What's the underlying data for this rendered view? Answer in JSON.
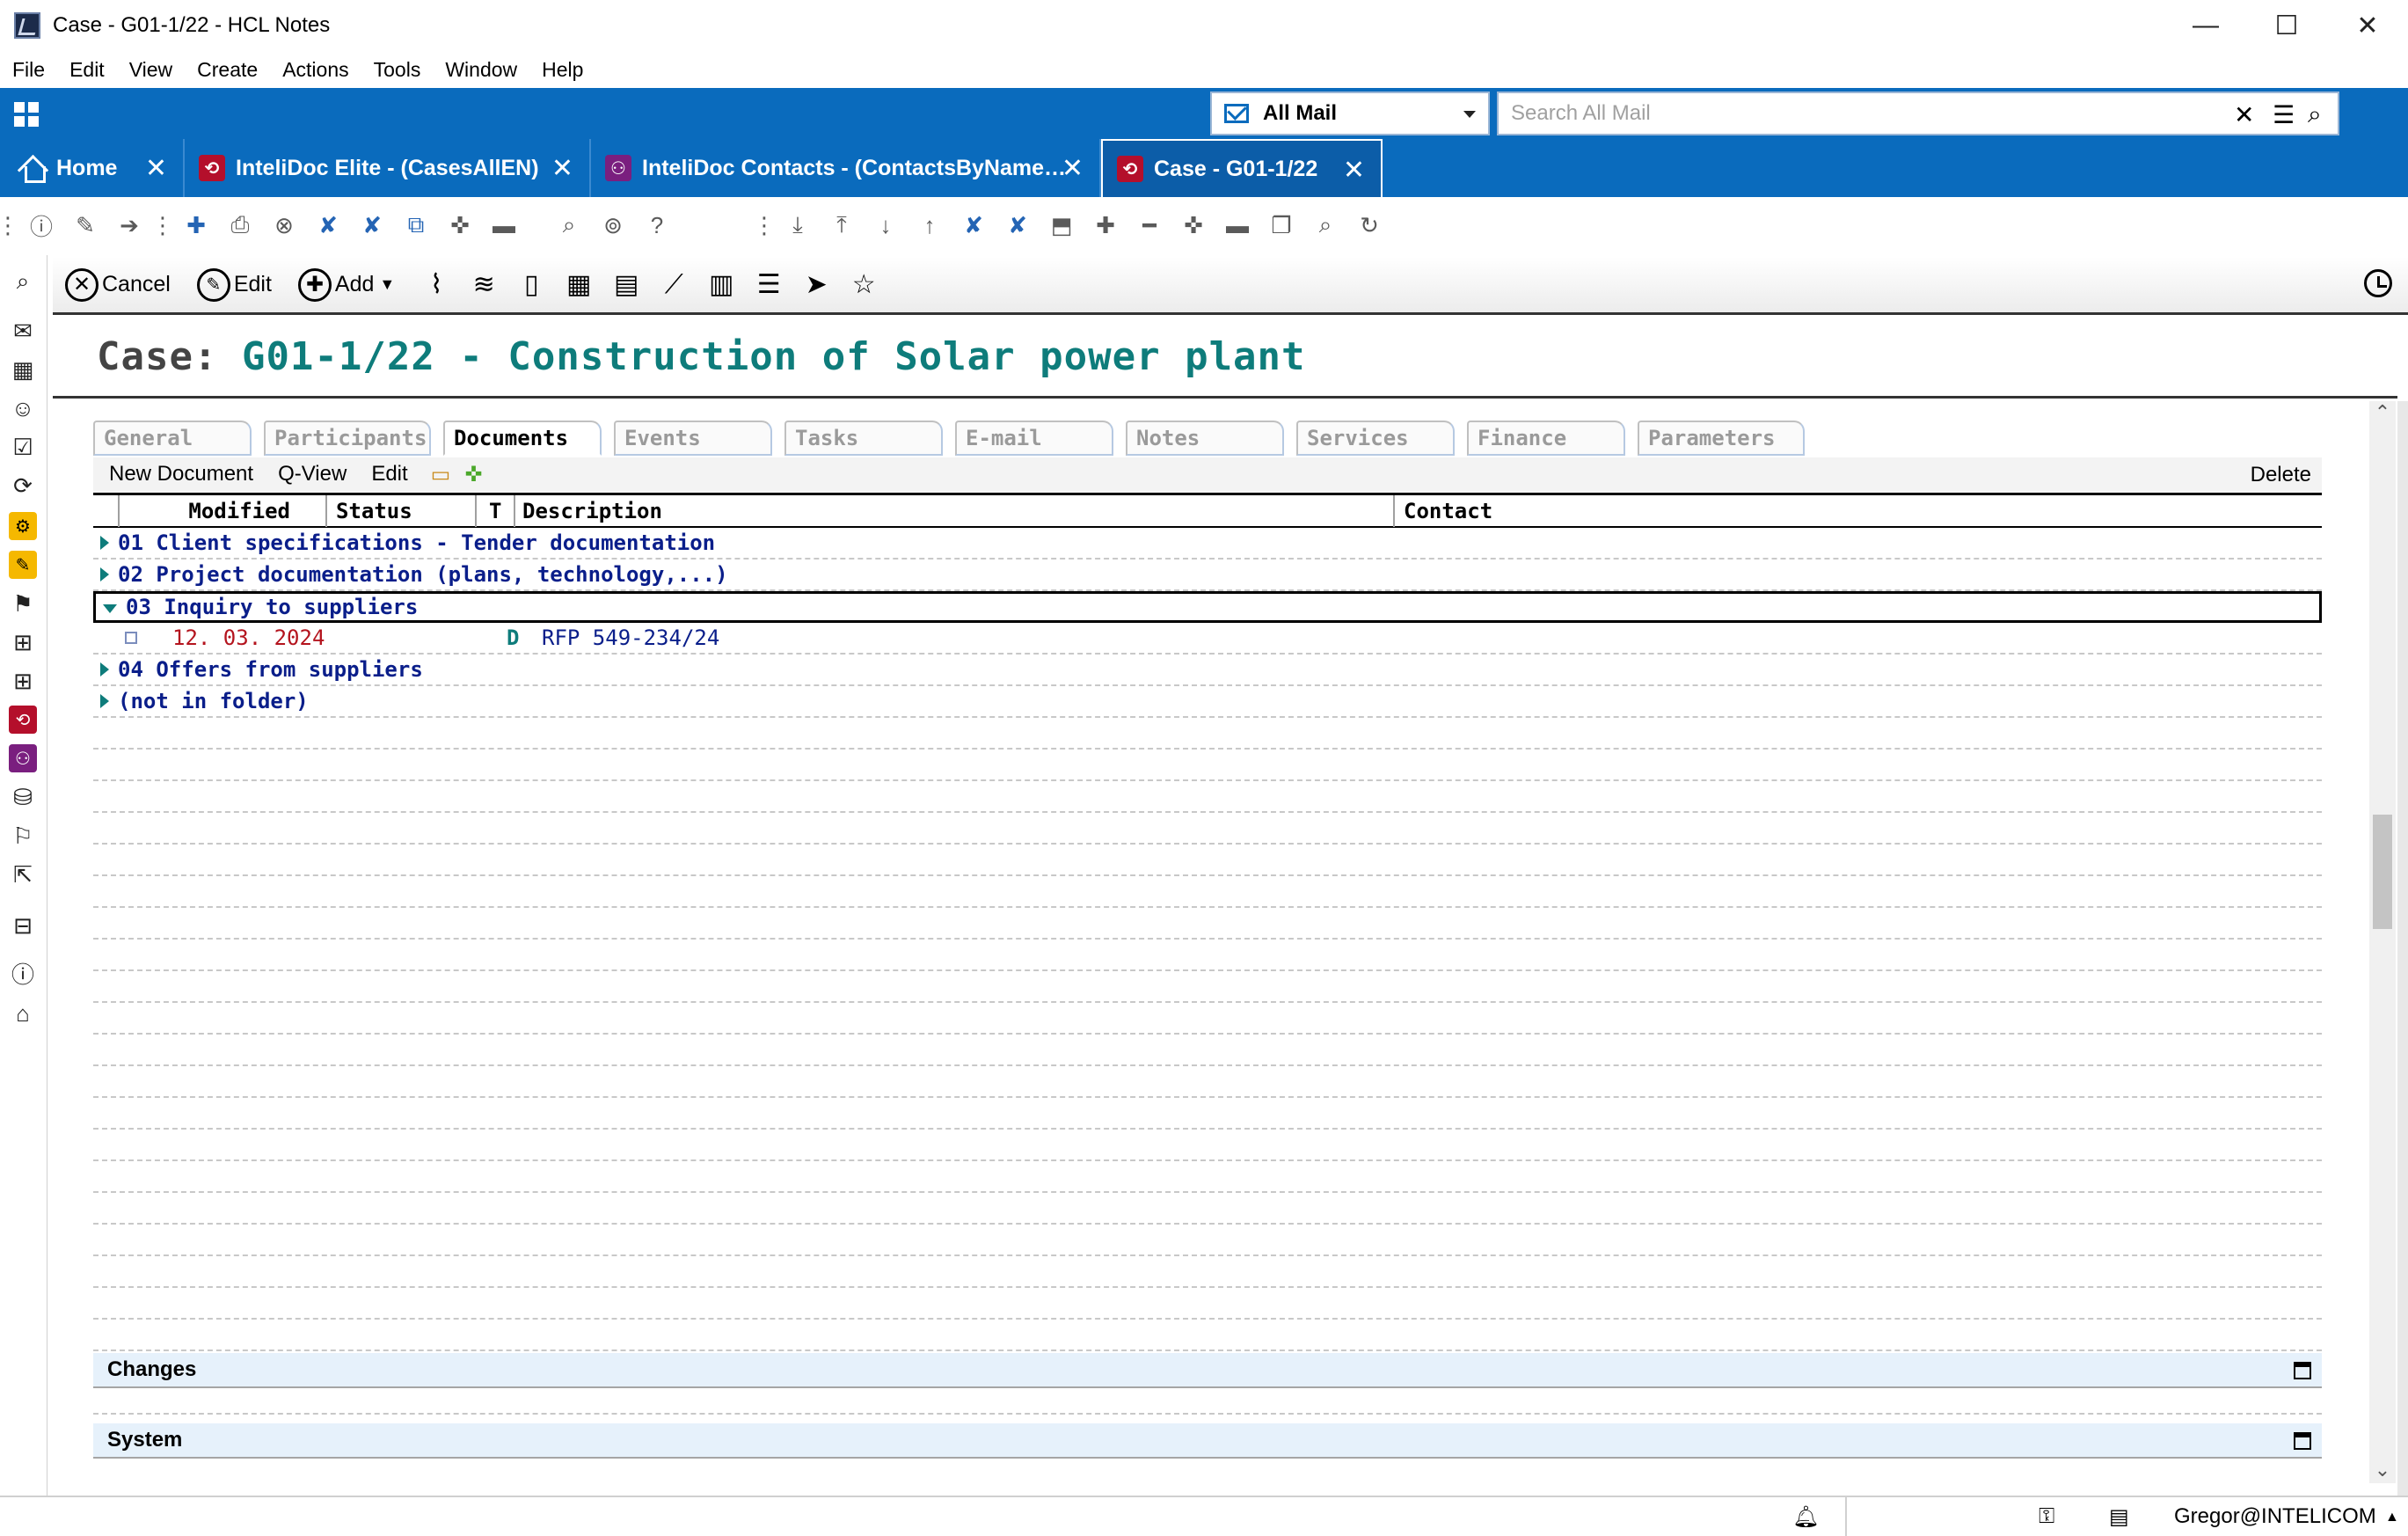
{
  "window": {
    "title": "Case - G01-1/22 - HCL Notes",
    "controls": {
      "minimize": "—",
      "maximize": "☐",
      "close": "✕"
    }
  },
  "menu": [
    "File",
    "Edit",
    "View",
    "Create",
    "Actions",
    "Tools",
    "Window",
    "Help"
  ],
  "topbar": {
    "mail_scope": "All Mail",
    "search_placeholder": "Search All Mail"
  },
  "tabs": [
    {
      "label": "Home",
      "icon": "home-icon"
    },
    {
      "label": "InteliDoc Elite - (CasesAllEN)",
      "icon": "intelidoc-elite-icon"
    },
    {
      "label": "InteliDoc Contacts - (ContactsByName…",
      "icon": "contacts-icon"
    },
    {
      "label": "Case - G01-1/22",
      "icon": "case-icon",
      "active": true
    }
  ],
  "actions": {
    "cancel": "Cancel",
    "edit": "Edit",
    "add": "Add"
  },
  "case": {
    "label": "Case:",
    "title": "G01-1/22 - Construction of Solar power plant"
  },
  "form_tabs": [
    {
      "label": "General"
    },
    {
      "label": "Participants"
    },
    {
      "label": "Documents",
      "active": true
    },
    {
      "label": "Events"
    },
    {
      "label": "Tasks"
    },
    {
      "label": "E-mail"
    },
    {
      "label": "Notes"
    },
    {
      "label": "Services"
    },
    {
      "label": "Finance"
    },
    {
      "label": "Parameters"
    }
  ],
  "doc_toolbar": {
    "new_document": "New Document",
    "q_view": "Q-View",
    "edit": "Edit",
    "delete": "Delete"
  },
  "columns": {
    "modified": "Modified",
    "status": "Status",
    "type": "T",
    "description": "Description",
    "contact": "Contact"
  },
  "folders": [
    {
      "label": "01 Client specifications - Tender documentation",
      "expanded": false
    },
    {
      "label": "02 Project documentation (plans, technology,...)",
      "expanded": false
    },
    {
      "label": "03 Inquiry to suppliers",
      "expanded": true,
      "documents": [
        {
          "modified": "12. 03. 2024",
          "type": "D",
          "description": "RFP 549-234/24"
        }
      ]
    },
    {
      "label": "04 Offers from suppliers",
      "expanded": false
    },
    {
      "label": "(not in folder)",
      "expanded": false
    }
  ],
  "panels": {
    "changes": "Changes",
    "system": "System"
  },
  "status": {
    "user": "Gregor@INTELICOM"
  },
  "colors": {
    "brand_blue": "#0a6bbd",
    "heading_teal": "#0e7c7b",
    "folder_navy": "#0a1e8a",
    "date_red": "#b4141e"
  }
}
